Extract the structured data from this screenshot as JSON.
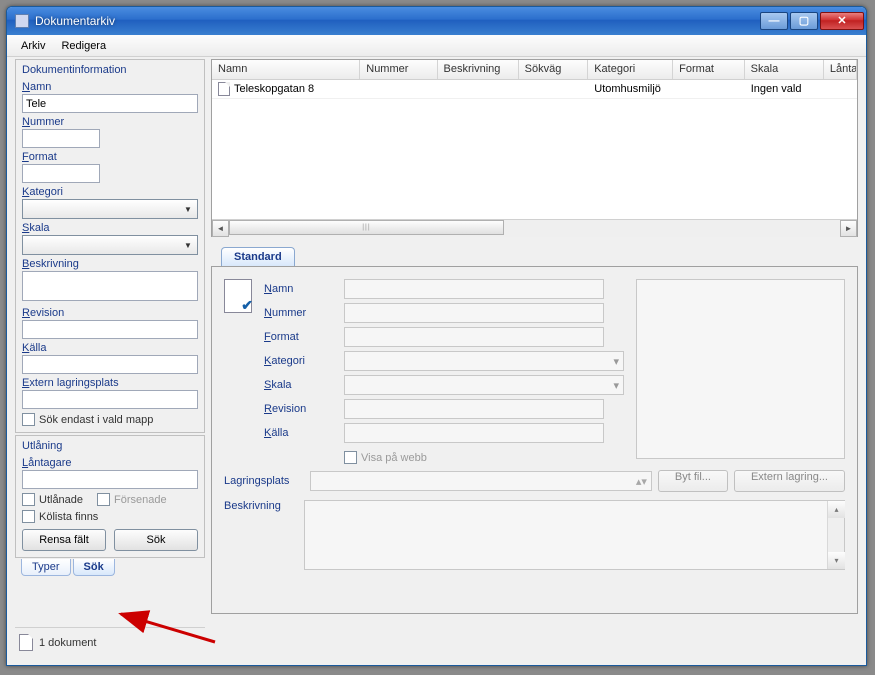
{
  "window": {
    "title": "Dokumentarkiv"
  },
  "menu": {
    "file": "Arkiv",
    "edit": "Redigera"
  },
  "sidebar": {
    "group_doc": "Dokumentinformation",
    "name_label": "Namn",
    "name_value": "Tele",
    "number_label": "Nummer",
    "format_label": "Format",
    "category_label": "Kategori",
    "scale_label": "Skala",
    "desc_label": "Beskrivning",
    "revision_label": "Revision",
    "source_label": "Källa",
    "ext_storage_label": "Extern lagringsplats",
    "search_only_folder": "Sök endast i vald mapp",
    "group_loan": "Utlåning",
    "borrower_label": "Låntagare",
    "loaned_out": "Utlånade",
    "overdue": "Försenade",
    "queue_exists": "Kölista finns",
    "clear_btn": "Rensa fält",
    "search_btn": "Sök",
    "tab_types": "Typer",
    "tab_search": "Sök"
  },
  "status": {
    "count_text": "1 dokument"
  },
  "grid": {
    "cols": [
      "Namn",
      "Nummer",
      "Beskrivning",
      "Sökväg",
      "Kategori",
      "Format",
      "Skala",
      "Lånta"
    ],
    "rows": [
      {
        "name": "Teleskopgatan 8",
        "number": "",
        "desc": "",
        "path": "",
        "category": "Utomhusmiljö",
        "format": "",
        "scale": "Ingen vald"
      }
    ]
  },
  "detail": {
    "tab": "Standard",
    "name": "Namn",
    "number": "Nummer",
    "format": "Format",
    "category": "Kategori",
    "scale": "Skala",
    "revision": "Revision",
    "source": "Källa",
    "show_web": "Visa på webb",
    "storage": "Lagringsplats",
    "browse": "Byt fil...",
    "ext_storage": "Extern lagring...",
    "description": "Beskrivning"
  }
}
